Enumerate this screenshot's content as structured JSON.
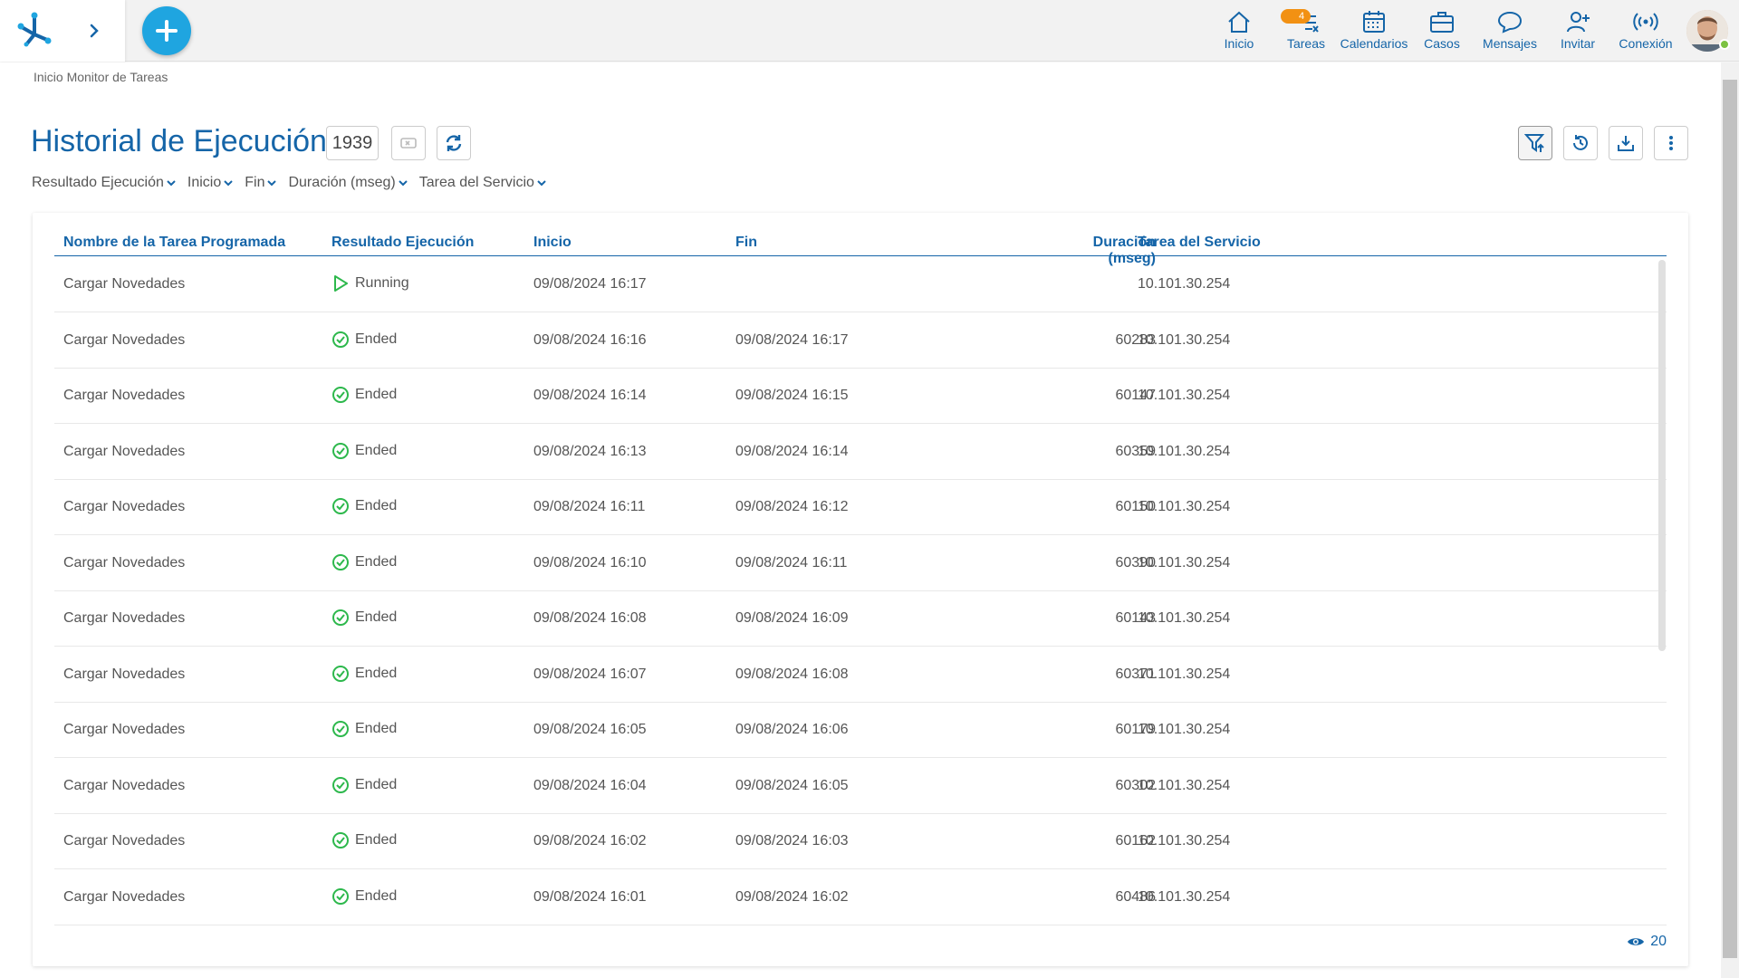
{
  "nav": {
    "items": [
      {
        "label": "Inicio",
        "icon": "home-icon"
      },
      {
        "label": "Tareas",
        "icon": "tasks-icon",
        "badge": "4"
      },
      {
        "label": "Calendarios",
        "icon": "calendar-icon"
      },
      {
        "label": "Casos",
        "icon": "briefcase-icon"
      },
      {
        "label": "Mensajes",
        "icon": "chat-icon"
      },
      {
        "label": "Invitar",
        "icon": "invite-user-icon"
      },
      {
        "label": "Conexión",
        "icon": "connection-icon"
      }
    ]
  },
  "breadcrumb": "Inicio Monitor de Tareas",
  "page": {
    "title": "Historial de Ejecución",
    "count": "1939"
  },
  "filters": [
    "Resultado Ejecución",
    "Inicio",
    "Fin",
    "Duración (mseg)",
    "Tarea del Servicio"
  ],
  "table": {
    "columns": [
      "Nombre de la Tarea Programada",
      "Resultado Ejecución",
      "Inicio",
      "Fin",
      "Duración (mseg)",
      "Tarea del Servicio"
    ],
    "rows": [
      [
        "Cargar Novedades",
        "Running",
        "09/08/2024 16:17",
        "",
        "",
        "10.101.30.254"
      ],
      [
        "Cargar Novedades",
        "Ended",
        "09/08/2024 16:16",
        "09/08/2024 16:17",
        "60283",
        "10.101.30.254"
      ],
      [
        "Cargar Novedades",
        "Ended",
        "09/08/2024 16:14",
        "09/08/2024 16:15",
        "60147",
        "10.101.30.254"
      ],
      [
        "Cargar Novedades",
        "Ended",
        "09/08/2024 16:13",
        "09/08/2024 16:14",
        "60359",
        "10.101.30.254"
      ],
      [
        "Cargar Novedades",
        "Ended",
        "09/08/2024 16:11",
        "09/08/2024 16:12",
        "60150",
        "10.101.30.254"
      ],
      [
        "Cargar Novedades",
        "Ended",
        "09/08/2024 16:10",
        "09/08/2024 16:11",
        "60390",
        "10.101.30.254"
      ],
      [
        "Cargar Novedades",
        "Ended",
        "09/08/2024 16:08",
        "09/08/2024 16:09",
        "60143",
        "10.101.30.254"
      ],
      [
        "Cargar Novedades",
        "Ended",
        "09/08/2024 16:07",
        "09/08/2024 16:08",
        "60371",
        "10.101.30.254"
      ],
      [
        "Cargar Novedades",
        "Ended",
        "09/08/2024 16:05",
        "09/08/2024 16:06",
        "60179",
        "10.101.30.254"
      ],
      [
        "Cargar Novedades",
        "Ended",
        "09/08/2024 16:04",
        "09/08/2024 16:05",
        "60302",
        "10.101.30.254"
      ],
      [
        "Cargar Novedades",
        "Ended",
        "09/08/2024 16:02",
        "09/08/2024 16:03",
        "60162",
        "10.101.30.254"
      ],
      [
        "Cargar Novedades",
        "Ended",
        "09/08/2024 16:01",
        "09/08/2024 16:02",
        "60486",
        "10.101.30.254"
      ]
    ]
  },
  "footer": {
    "visible_count": "20"
  },
  "colors": {
    "accent": "#1565a8",
    "add_button": "#1fa5e0",
    "badge": "#f29113",
    "status_ok": "#2db84c",
    "online": "#7cc242"
  }
}
